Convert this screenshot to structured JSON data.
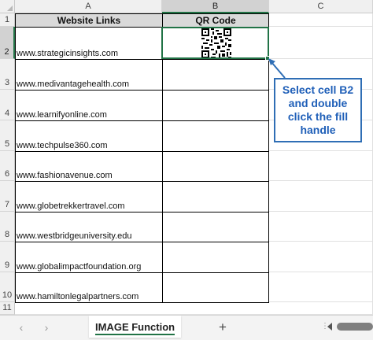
{
  "columns": [
    "A",
    "B",
    "C"
  ],
  "rows": [
    "1",
    "2",
    "3",
    "4",
    "5",
    "6",
    "7",
    "8",
    "9",
    "10",
    "11"
  ],
  "table": {
    "header_a": "Website Links",
    "header_b": "QR Code",
    "links": [
      "www.strategicinsights.com",
      "www.medivantagehealth.com",
      "www.learnifyonline.com",
      "www.techpulse360.com",
      "www.fashionavenue.com",
      "www.globetrekkertravel.com",
      "www.westbridgeuniversity.edu",
      "www.globalimpactfoundation.org",
      "www.hamiltonlegalpartners.com"
    ]
  },
  "callout": {
    "text": "Select cell B2 and double click the fill handle",
    "color": "#2f6eb5"
  },
  "tabs": {
    "prev_icon": "chevron-left-icon",
    "next_icon": "chevron-right-icon",
    "active_tab": "IMAGE Function",
    "add_icon": "plus-icon",
    "accent": "#217346"
  }
}
